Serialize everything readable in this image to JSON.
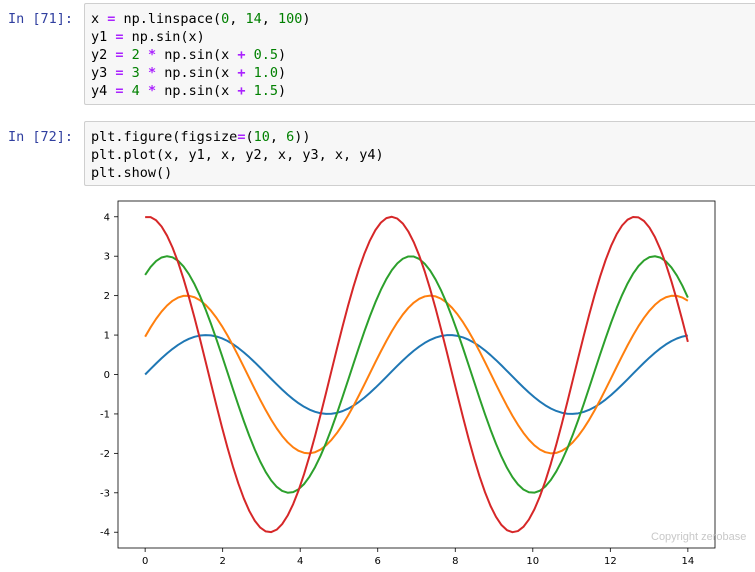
{
  "cells": [
    {
      "prompt": "In [71]:",
      "lines": [
        [
          {
            "t": "x "
          },
          {
            "t": "=",
            "c": "op"
          },
          {
            "t": " np.linspace("
          },
          {
            "t": "0",
            "c": "num"
          },
          {
            "t": ", "
          },
          {
            "t": "14",
            "c": "num"
          },
          {
            "t": ", "
          },
          {
            "t": "100",
            "c": "num"
          },
          {
            "t": ")"
          }
        ],
        [
          {
            "t": "y1 "
          },
          {
            "t": "=",
            "c": "op"
          },
          {
            "t": " np.sin(x)"
          }
        ],
        [
          {
            "t": "y2 "
          },
          {
            "t": "=",
            "c": "op"
          },
          {
            "t": " "
          },
          {
            "t": "2",
            "c": "num"
          },
          {
            "t": " "
          },
          {
            "t": "*",
            "c": "op"
          },
          {
            "t": " np.sin(x "
          },
          {
            "t": "+",
            "c": "op"
          },
          {
            "t": " "
          },
          {
            "t": "0.5",
            "c": "num"
          },
          {
            "t": ")"
          }
        ],
        [
          {
            "t": "y3 "
          },
          {
            "t": "=",
            "c": "op"
          },
          {
            "t": " "
          },
          {
            "t": "3",
            "c": "num"
          },
          {
            "t": " "
          },
          {
            "t": "*",
            "c": "op"
          },
          {
            "t": " np.sin(x "
          },
          {
            "t": "+",
            "c": "op"
          },
          {
            "t": " "
          },
          {
            "t": "1.0",
            "c": "num"
          },
          {
            "t": ")"
          }
        ],
        [
          {
            "t": "y4 "
          },
          {
            "t": "=",
            "c": "op"
          },
          {
            "t": " "
          },
          {
            "t": "4",
            "c": "num"
          },
          {
            "t": " "
          },
          {
            "t": "*",
            "c": "op"
          },
          {
            "t": " np.sin(x "
          },
          {
            "t": "+",
            "c": "op"
          },
          {
            "t": " "
          },
          {
            "t": "1.5",
            "c": "num"
          },
          {
            "t": ")"
          }
        ]
      ]
    },
    {
      "prompt": "In [72]:",
      "lines": [
        [
          {
            "t": "plt.figure(figsize"
          },
          {
            "t": "=",
            "c": "op"
          },
          {
            "t": "("
          },
          {
            "t": "10",
            "c": "num"
          },
          {
            "t": ", "
          },
          {
            "t": "6",
            "c": "num"
          },
          {
            "t": "))"
          }
        ],
        [
          {
            "t": "plt.plot(x, y1, x, y2, x, y3, x, y4)"
          }
        ],
        [
          {
            "t": "plt.show()"
          }
        ]
      ]
    }
  ],
  "colors": {
    "prompt": "#303F9F",
    "operator": "#AA22FF",
    "number": "#008000",
    "series": [
      "#1f77b4",
      "#ff7f0e",
      "#2ca02c",
      "#d62728"
    ]
  },
  "chart_data": {
    "type": "line",
    "title": "",
    "xlabel": "",
    "ylabel": "",
    "xlim": [
      -0.7,
      14.7
    ],
    "ylim": [
      -4.4,
      4.4
    ],
    "x_ticks": [
      "0",
      "2",
      "4",
      "6",
      "8",
      "10",
      "12",
      "14"
    ],
    "y_ticks": [
      "4",
      "3",
      "2",
      "1",
      "0",
      "-1",
      "-2",
      "-3",
      "-4"
    ],
    "x": {
      "start": 0,
      "stop": 14,
      "num": 100
    },
    "series": [
      {
        "amplitude": 1,
        "phase": 0.0
      },
      {
        "amplitude": 2,
        "phase": 0.5
      },
      {
        "amplitude": 3,
        "phase": 1.0
      },
      {
        "amplitude": 4,
        "phase": 1.5
      }
    ],
    "grid": false,
    "legend": "none"
  },
  "watermark": "Copyright zerobase"
}
